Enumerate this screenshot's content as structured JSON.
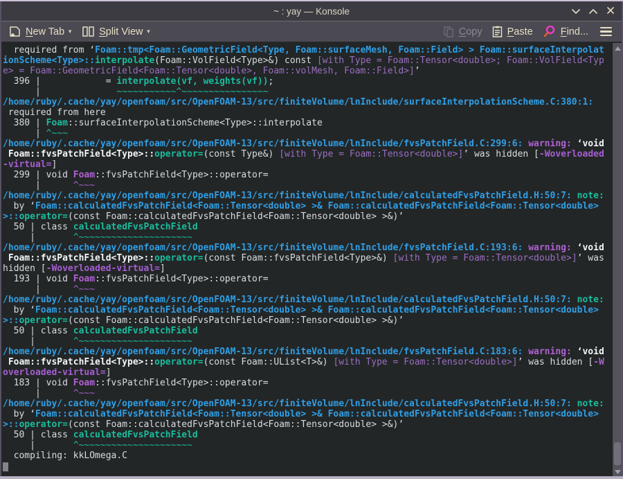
{
  "window": {
    "title": "~ : yay — Konsole"
  },
  "titlebar_icons": [
    "chevron-down-icon",
    "chevron-up-icon",
    "close-icon"
  ],
  "toolbar": {
    "new_tab": {
      "accel": "N",
      "rest": "ew Tab"
    },
    "split_view": {
      "accel": "S",
      "rest": "plit View"
    },
    "copy": {
      "accel": "C",
      "rest": "opy"
    },
    "paste": {
      "accel": "P",
      "rest": "aste"
    },
    "find": {
      "accel": "F",
      "rest": "ind..."
    }
  },
  "colors": {
    "terminal_bg": "#232627",
    "toolbar_bg": "#4b4951",
    "titlebar_bg": "#3c3b42",
    "frame_light": "#b7b1c1",
    "toolbar_text": "#e6dfc4",
    "text_normal": "#dadde0",
    "text_bold": "#f4f6f7",
    "path_blue": "#2f9fe6",
    "teal": "#1abc9c",
    "warning_magenta": "#b061d6",
    "purple": "#9a6fc0",
    "find_icon_pink": "#e83cc0",
    "find_icon_orange": "#e2612b"
  },
  "terminal": {
    "lines": [
      [
        [
          "n",
          "  required from ‘"
        ],
        [
          "q",
          "Foam::tmp<Foam::GeometricField<Type, Foam::surfaceMesh, Foam::Field> > Foam::surfaceInterpolat"
        ]
      ],
      [
        [
          "q",
          "ionScheme<Type>::"
        ],
        [
          "t",
          "interpolate"
        ],
        [
          "n",
          "(Foam::VolField<Type>&) const "
        ],
        [
          "p",
          "[with Type = Foam::Tensor<double>; Foam::VolField<Typ"
        ]
      ],
      [
        [
          "p",
          "e> = Foam::GeometricField<Foam::Tensor<double>, Foam::volMesh, Foam::Field>]"
        ],
        [
          "n",
          "’"
        ]
      ],
      [
        [
          "n",
          "  396 |            = "
        ],
        [
          "t",
          "interpolate(vf, weights(vf))"
        ],
        [
          "n",
          ";"
        ]
      ],
      [
        [
          "n",
          "      |              "
        ],
        [
          "ts",
          "~~~~~~~~~~~^~~~~~~~~~~~~~~~~"
        ]
      ],
      [
        [
          "q",
          "/home/ruby/.cache/yay/openfoam/src/OpenFOAM-13/src/finiteVolume/lnInclude/surfaceInterpolationScheme.C:380:1:"
        ]
      ],
      [
        [
          "n",
          " required from here"
        ]
      ],
      [
        [
          "n",
          "  380 | "
        ],
        [
          "t",
          "Foam"
        ],
        [
          "n",
          "::surfaceInterpolationScheme<Type>::interpolate"
        ]
      ],
      [
        [
          "n",
          "      | "
        ],
        [
          "ts",
          "^~~~"
        ]
      ],
      [
        [
          "q",
          "/home/ruby/.cache/yay/openfoam/src/OpenFOAM-13/src/finiteVolume/lnInclude/fvsPatchField.C:299:6: "
        ],
        [
          "m",
          "warning: "
        ],
        [
          "b",
          "‘void"
        ]
      ],
      [
        [
          "b",
          " Foam::fvsPatchField<Type>::"
        ],
        [
          "t",
          "operator="
        ],
        [
          "n",
          "(const Type&) "
        ],
        [
          "p",
          "[with Type = Foam::Tensor<double>]"
        ],
        [
          "n",
          "’ was hidden ["
        ],
        [
          "pb",
          "-Woverloaded"
        ]
      ],
      [
        [
          "pb",
          "-virtual="
        ],
        [
          "n",
          "]"
        ]
      ],
      [
        [
          "n",
          "  299 | void "
        ],
        [
          "m",
          "Foam"
        ],
        [
          "n",
          "::fvsPatchField<Type>::operator="
        ]
      ],
      [
        [
          "n",
          "      |      "
        ],
        [
          "ms",
          "^~~~"
        ]
      ],
      [
        [
          "q",
          "/home/ruby/.cache/yay/openfoam/src/OpenFOAM-13/src/finiteVolume/lnInclude/calculatedFvsPatchField.H:50:7: "
        ],
        [
          "t",
          "note:"
        ]
      ],
      [
        [
          "n",
          "  by ‘"
        ],
        [
          "q",
          "Foam::calculatedFvsPatchField<Foam::Tensor<double> >& Foam::calculatedFvsPatchField<Foam::Tensor<double>"
        ]
      ],
      [
        [
          "q",
          ">::"
        ],
        [
          "t",
          "operator="
        ],
        [
          "n",
          "(const Foam::calculatedFvsPatchField<Foam::Tensor<double> >&)’"
        ]
      ],
      [
        [
          "n",
          "  50 | class "
        ],
        [
          "t",
          "calculatedFvsPatchField"
        ]
      ],
      [
        [
          "n",
          "     |       "
        ],
        [
          "ts",
          "^~~~~~~~~~~~~~~~~~~~~~"
        ]
      ],
      [
        [
          "q",
          "/home/ruby/.cache/yay/openfoam/src/OpenFOAM-13/src/finiteVolume/lnInclude/fvsPatchField.C:193:6: "
        ],
        [
          "m",
          "warning: "
        ],
        [
          "b",
          "‘void"
        ]
      ],
      [
        [
          "b",
          " Foam::fvsPatchField<Type>::"
        ],
        [
          "t",
          "operator="
        ],
        [
          "n",
          "(const Foam::fvsPatchField<Type>&) "
        ],
        [
          "p",
          "[with Type = Foam::Tensor<double>]"
        ],
        [
          "n",
          "’ was"
        ]
      ],
      [
        [
          "n",
          "hidden ["
        ],
        [
          "pb",
          "-Woverloaded-virtual="
        ],
        [
          "n",
          "]"
        ]
      ],
      [
        [
          "n",
          "  193 | void "
        ],
        [
          "m",
          "Foam"
        ],
        [
          "n",
          "::fvsPatchField<Type>::operator="
        ]
      ],
      [
        [
          "n",
          "      |      "
        ],
        [
          "ms",
          "^~~~"
        ]
      ],
      [
        [
          "q",
          "/home/ruby/.cache/yay/openfoam/src/OpenFOAM-13/src/finiteVolume/lnInclude/calculatedFvsPatchField.H:50:7: "
        ],
        [
          "t",
          "note:"
        ]
      ],
      [
        [
          "n",
          "  by ‘"
        ],
        [
          "q",
          "Foam::calculatedFvsPatchField<Foam::Tensor<double> >& Foam::calculatedFvsPatchField<Foam::Tensor<double>"
        ]
      ],
      [
        [
          "q",
          ">::"
        ],
        [
          "t",
          "operator="
        ],
        [
          "n",
          "(const Foam::calculatedFvsPatchField<Foam::Tensor<double> >&)’"
        ]
      ],
      [
        [
          "n",
          "  50 | class "
        ],
        [
          "t",
          "calculatedFvsPatchField"
        ]
      ],
      [
        [
          "n",
          "     |       "
        ],
        [
          "ts",
          "^~~~~~~~~~~~~~~~~~~~~~"
        ]
      ],
      [
        [
          "q",
          "/home/ruby/.cache/yay/openfoam/src/OpenFOAM-13/src/finiteVolume/lnInclude/fvsPatchField.C:183:6: "
        ],
        [
          "m",
          "warning: "
        ],
        [
          "b",
          "‘void"
        ]
      ],
      [
        [
          "b",
          " Foam::fvsPatchField<Type>::"
        ],
        [
          "t",
          "operator="
        ],
        [
          "n",
          "(const Foam::UList<T>&) "
        ],
        [
          "p",
          "[with Type = Foam::Tensor<double>]"
        ],
        [
          "n",
          "’ was hidden ["
        ],
        [
          "pb",
          "-W"
        ]
      ],
      [
        [
          "pb",
          "overloaded-virtual="
        ],
        [
          "n",
          "]"
        ]
      ],
      [
        [
          "n",
          "  183 | void "
        ],
        [
          "m",
          "Foam"
        ],
        [
          "n",
          "::fvsPatchField<Type>::operator="
        ]
      ],
      [
        [
          "n",
          "      |      "
        ],
        [
          "ms",
          "^~~~"
        ]
      ],
      [
        [
          "q",
          "/home/ruby/.cache/yay/openfoam/src/OpenFOAM-13/src/finiteVolume/lnInclude/calculatedFvsPatchField.H:50:7: "
        ],
        [
          "t",
          "note:"
        ]
      ],
      [
        [
          "n",
          "  by ‘"
        ],
        [
          "q",
          "Foam::calculatedFvsPatchField<Foam::Tensor<double> >& Foam::calculatedFvsPatchField<Foam::Tensor<double>"
        ]
      ],
      [
        [
          "q",
          ">::"
        ],
        [
          "t",
          "operator="
        ],
        [
          "n",
          "(const Foam::calculatedFvsPatchField<Foam::Tensor<double> >&)’"
        ]
      ],
      [
        [
          "n",
          "  50 | class "
        ],
        [
          "t",
          "calculatedFvsPatchField"
        ]
      ],
      [
        [
          "n",
          "     |       "
        ],
        [
          "ts",
          "^~~~~~~~~~~~~~~~~~~~~~"
        ]
      ],
      [
        [
          "n",
          "  compiling: kkLOmega.C"
        ]
      ],
      [
        [
          "cursor",
          ""
        ]
      ]
    ]
  }
}
